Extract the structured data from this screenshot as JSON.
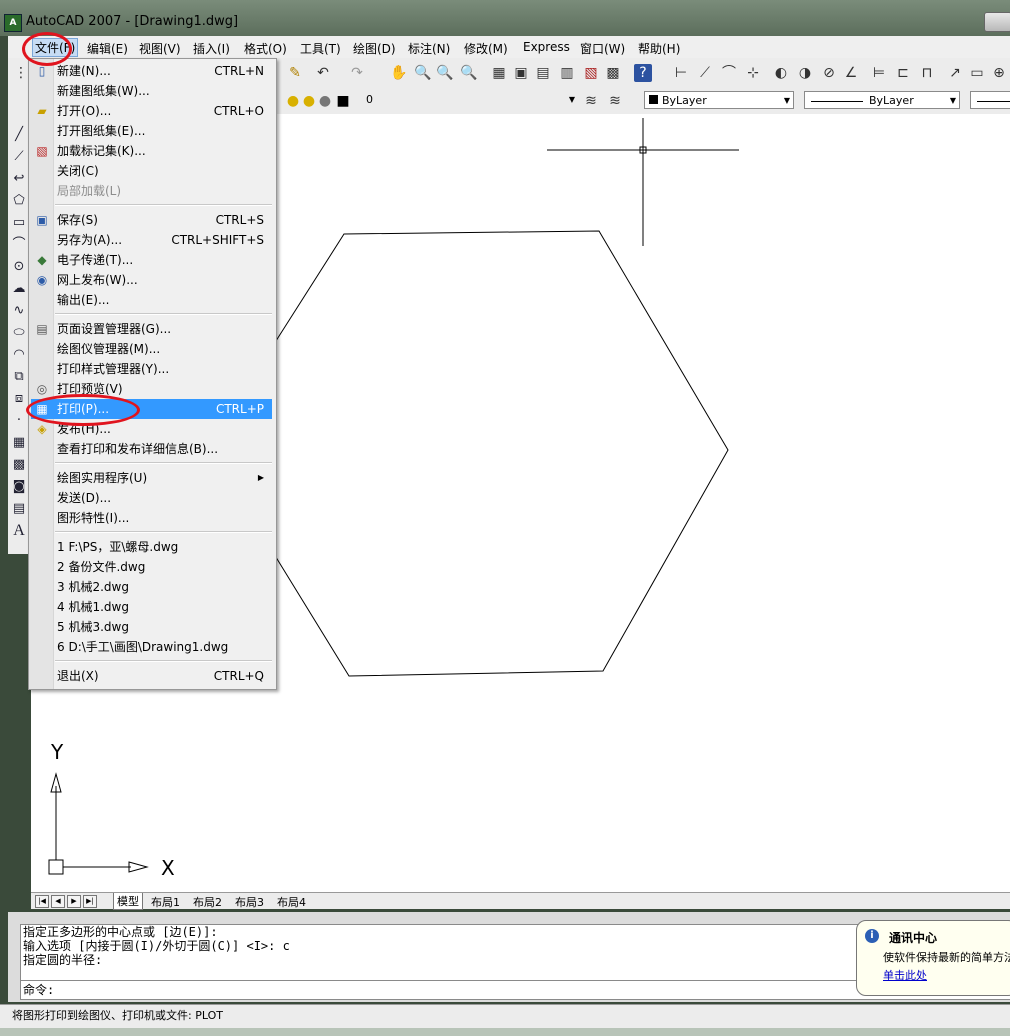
{
  "window": {
    "title": "AutoCAD 2007 - [Drawing1.dwg]",
    "icon": "autocad-app-icon"
  },
  "menubar": {
    "items": [
      "文件(F)",
      "编辑(E)",
      "视图(V)",
      "插入(I)",
      "格式(O)",
      "工具(T)",
      "绘图(D)",
      "标注(N)",
      "修改(M)",
      "Express",
      "窗口(W)",
      "帮助(H)"
    ]
  },
  "toolbar2": {
    "layer_value": "0",
    "color_value": "ByLayer",
    "linetype_value": "ByLayer"
  },
  "file_menu": {
    "items": [
      {
        "label": "新建(N)...",
        "shortcut": "CTRL+N",
        "icon": "new-file-icon"
      },
      {
        "label": "新建图纸集(W)...",
        "shortcut": "",
        "icon": ""
      },
      {
        "label": "打开(O)...",
        "shortcut": "CTRL+O",
        "icon": "open-folder-icon"
      },
      {
        "label": "打开图纸集(E)...",
        "shortcut": "",
        "icon": ""
      },
      {
        "label": "加载标记集(K)...",
        "shortcut": "",
        "icon": "markup-icon"
      },
      {
        "label": "关闭(C)",
        "shortcut": "",
        "icon": ""
      },
      {
        "label": "局部加载(L)",
        "shortcut": "",
        "icon": ""
      },
      {
        "label": "保存(S)",
        "shortcut": "CTRL+S",
        "icon": "save-icon"
      },
      {
        "label": "另存为(A)...",
        "shortcut": "CTRL+SHIFT+S",
        "icon": ""
      },
      {
        "label": "电子传递(T)...",
        "shortcut": "",
        "icon": "etransmit-icon"
      },
      {
        "label": "网上发布(W)...",
        "shortcut": "",
        "icon": "publish-web-icon"
      },
      {
        "label": "输出(E)...",
        "shortcut": "",
        "icon": ""
      },
      {
        "label": "页面设置管理器(G)...",
        "shortcut": "",
        "icon": "page-setup-icon"
      },
      {
        "label": "绘图仪管理器(M)...",
        "shortcut": "",
        "icon": ""
      },
      {
        "label": "打印样式管理器(Y)...",
        "shortcut": "",
        "icon": ""
      },
      {
        "label": "打印预览(V)",
        "shortcut": "",
        "icon": "print-preview-icon"
      },
      {
        "label": "打印(P)...",
        "shortcut": "CTRL+P",
        "icon": "print-icon"
      },
      {
        "label": "发布(H)...",
        "shortcut": "",
        "icon": "publish-icon"
      },
      {
        "label": "查看打印和发布详细信息(B)...",
        "shortcut": "",
        "icon": ""
      },
      {
        "label": "绘图实用程序(U)",
        "shortcut": "",
        "icon": ""
      },
      {
        "label": "发送(D)...",
        "shortcut": "",
        "icon": ""
      },
      {
        "label": "图形特性(I)...",
        "shortcut": "",
        "icon": ""
      },
      {
        "label": "1 F:\\PS，亚\\螺母.dwg",
        "shortcut": "",
        "icon": ""
      },
      {
        "label": "2 备份文件.dwg",
        "shortcut": "",
        "icon": ""
      },
      {
        "label": "3 机械2.dwg",
        "shortcut": "",
        "icon": ""
      },
      {
        "label": "4 机械1.dwg",
        "shortcut": "",
        "icon": ""
      },
      {
        "label": "5 机械3.dwg",
        "shortcut": "",
        "icon": ""
      },
      {
        "label": "6 D:\\手工\\画图\\Drawing1.dwg",
        "shortcut": "",
        "icon": ""
      },
      {
        "label": "退出(X)",
        "shortcut": "CTRL+Q",
        "icon": ""
      }
    ]
  },
  "ucs": {
    "x_label": "X",
    "y_label": "Y"
  },
  "layout_tabs": [
    "模型",
    "布局1",
    "布局2",
    "布局3",
    "布局4"
  ],
  "command": {
    "history": [
      "指定正多边形的中心点或 [边(E)]:",
      "输入选项 [内接于圆(I)/外切于圆(C)] <I>: c",
      "指定圆的半径:"
    ],
    "prompt": "命令:"
  },
  "status": {
    "text": "将图形打印到绘图仪、打印机或文件:  PLOT"
  },
  "balloon": {
    "title": "通讯中心",
    "line1": "使软件保持最新的简单方法",
    "line2": "单击此处"
  },
  "colors": {
    "highlight": "#3399ff",
    "annotation_red": "#e0141e"
  }
}
